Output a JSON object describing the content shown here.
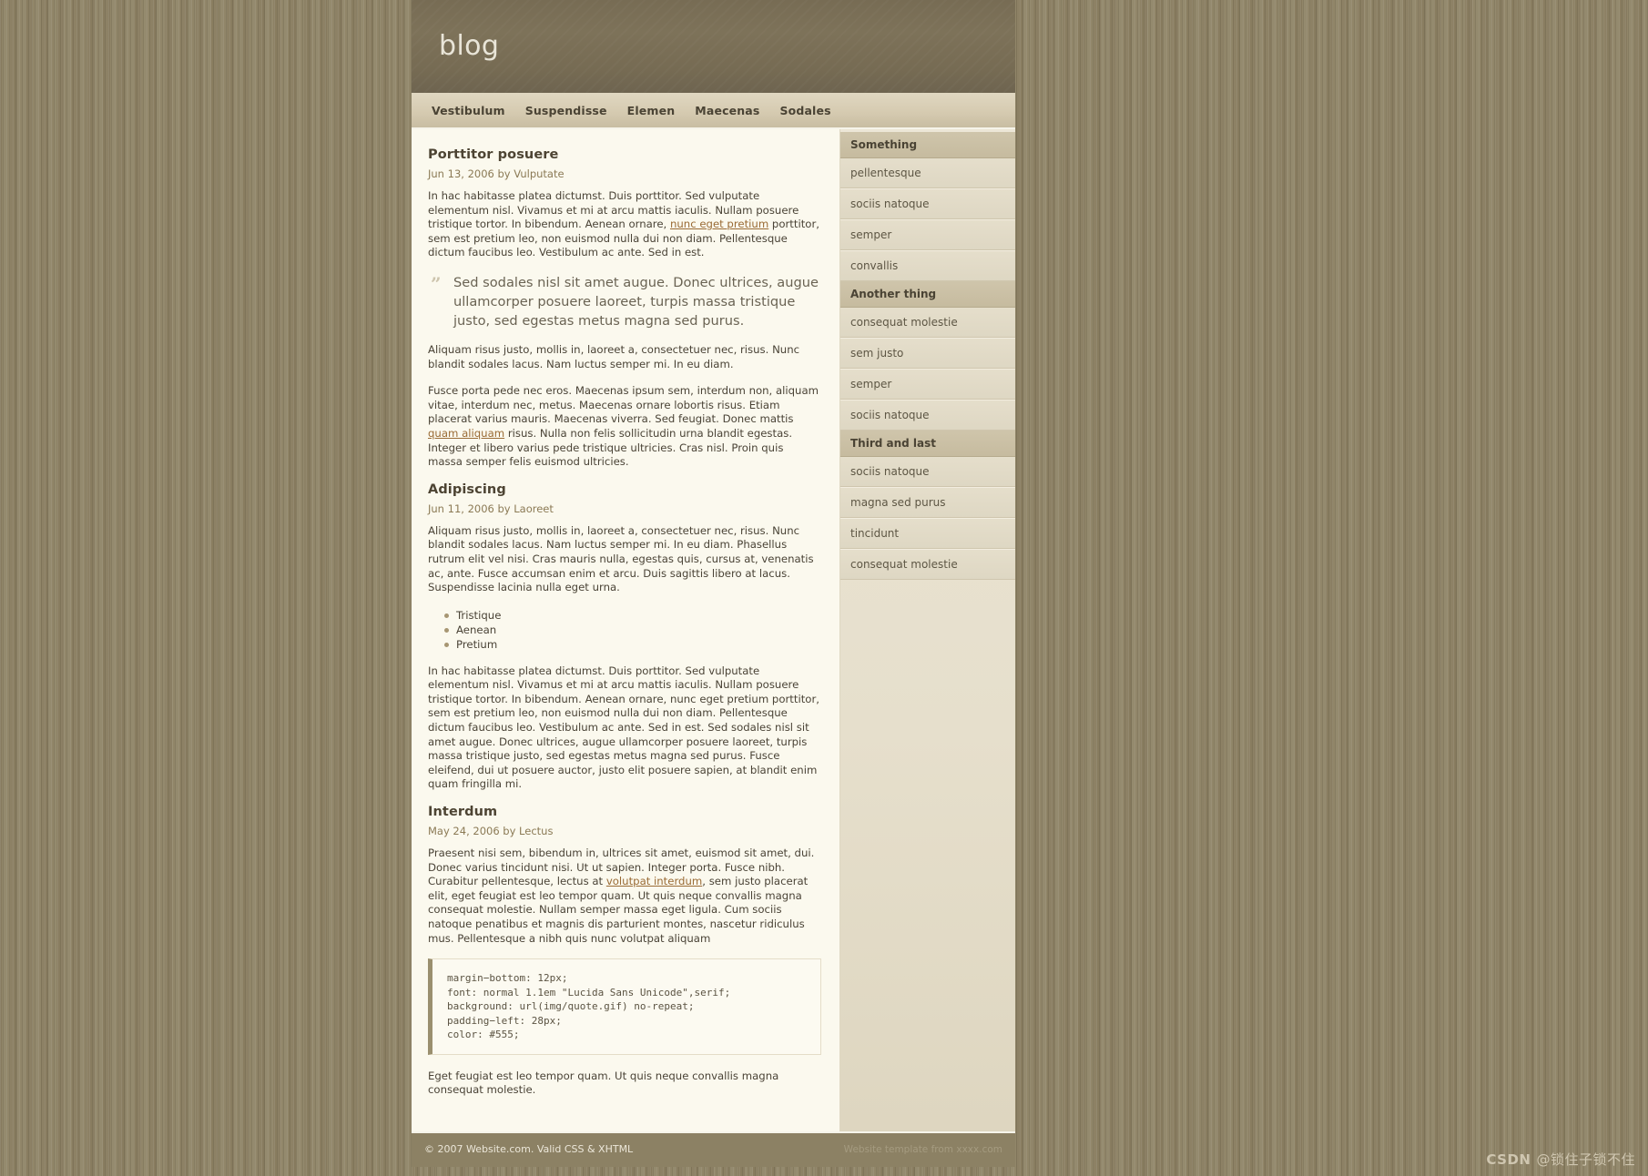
{
  "site": {
    "title": "blog"
  },
  "nav": {
    "items": [
      {
        "label": "Vestibulum"
      },
      {
        "label": "Suspendisse"
      },
      {
        "label": "Elemen"
      },
      {
        "label": "Maecenas"
      },
      {
        "label": "Sodales"
      }
    ]
  },
  "posts": [
    {
      "title": "Porttitor posuere",
      "meta": "Jun 13, 2006 by Vulputate",
      "para1_a": "In hac habitasse platea dictumst. Duis porttitor. Sed vulputate elementum nisl. Vivamus et mi at arcu mattis iaculis. Nullam posuere tristique tortor. In bibendum. Aenean ornare, ",
      "para1_link": "nunc eget pretium",
      "para1_b": " porttitor, sem est pretium leo, non euismod nulla dui non diam. Pellentesque dictum faucibus leo. Vestibulum ac ante. Sed in est.",
      "quote_mark": "”",
      "quote": "Sed sodales nisl sit amet augue. Donec ultrices, augue ullamcorper posuere laoreet, turpis massa tristique justo, sed egestas metus magna sed purus.",
      "para2": "Aliquam risus justo, mollis in, laoreet a, consectetuer nec, risus. Nunc blandit sodales lacus. Nam luctus semper mi. In eu diam.",
      "para3_a": "Fusce porta pede nec eros. Maecenas ipsum sem, interdum non, aliquam vitae, interdum nec, metus. Maecenas ornare lobortis risus. Etiam placerat varius mauris. Maecenas viverra. Sed feugiat. Donec mattis ",
      "para3_link": "quam aliquam",
      "para3_b": " risus. Nulla non felis sollicitudin urna blandit egestas. Integer et libero varius pede tristique ultricies. Cras nisl. Proin quis massa semper felis euismod ultricies."
    },
    {
      "title": "Adipiscing",
      "meta": "Jun 11, 2006 by Laoreet",
      "para1": "Aliquam risus justo, mollis in, laoreet a, consectetuer nec, risus. Nunc blandit sodales lacus. Nam luctus semper mi. In eu diam. Phasellus rutrum elit vel nisi. Cras mauris nulla, egestas quis, cursus at, venenatis ac, ante. Fusce accumsan enim et arcu. Duis sagittis libero at lacus. Suspendisse lacinia nulla eget urna.",
      "bullets": [
        "Tristique",
        "Aenean",
        "Pretium"
      ],
      "para2": "In hac habitasse platea dictumst. Duis porttitor. Sed vulputate elementum nisl. Vivamus et mi at arcu mattis iaculis. Nullam posuere tristique tortor. In bibendum. Aenean ornare, nunc eget pretium porttitor, sem est pretium leo, non euismod nulla dui non diam. Pellentesque dictum faucibus leo. Vestibulum ac ante. Sed in est. Sed sodales nisl sit amet augue. Donec ultrices, augue ullamcorper posuere laoreet, turpis massa tristique justo, sed egestas metus magna sed purus. Fusce eleifend, dui ut posuere auctor, justo elit posuere sapien, at blandit enim quam fringilla mi."
    },
    {
      "title": "Interdum",
      "meta": "May 24, 2006 by Lectus",
      "para1_a": "Praesent nisi sem, bibendum in, ultrices sit amet, euismod sit amet, dui. Donec varius tincidunt nisi. Ut ut sapien. Integer porta. Fusce nibh. Curabitur pellentesque, lectus at ",
      "para1_link": "volutpat interdum",
      "para1_b": ", sem justo placerat elit, eget feugiat est leo tempor quam. Ut quis neque convallis magna consequat molestie. Nullam semper massa eget ligula. Cum sociis natoque penatibus et magnis dis parturient montes, nascetur ridiculus mus. Pellentesque a nibh quis nunc volutpat aliquam",
      "code": "margin−bottom: 12px;\nfont: normal 1.1em \"Lucida Sans Unicode\",serif;\nbackground: url(img/quote.gif) no-repeat;\npadding−left: 28px;\ncolor: #555;",
      "para2": "Eget feugiat est leo tempor quam. Ut quis neque convallis magna consequat molestie."
    }
  ],
  "sidebar": {
    "sections": [
      {
        "heading": "Something",
        "items": [
          "pellentesque",
          "sociis natoque",
          "semper",
          "convallis"
        ]
      },
      {
        "heading": "Another thing",
        "items": [
          "consequat molestie",
          "sem justo",
          "semper",
          "sociis natoque"
        ]
      },
      {
        "heading": "Third and last",
        "items": [
          "sociis natoque",
          "magna sed purus",
          "tincidunt",
          "consequat molestie"
        ]
      }
    ]
  },
  "footer": {
    "left": "© 2007 Website.com. Valid CSS & XHTML",
    "right": "Website template from xxxx.com"
  },
  "watermark": {
    "brand": "CSDN",
    "user": "@锁住子锁不住"
  },
  "colors": {
    "page_bg": "#8d8163",
    "masthead": "#7d7259",
    "nav": "#d6cbb1",
    "content_bg": "#fbf9ee",
    "sidebar_bg": "#e6dfcc",
    "link": "#9a6b35",
    "footer_bg": "#8c8164"
  }
}
